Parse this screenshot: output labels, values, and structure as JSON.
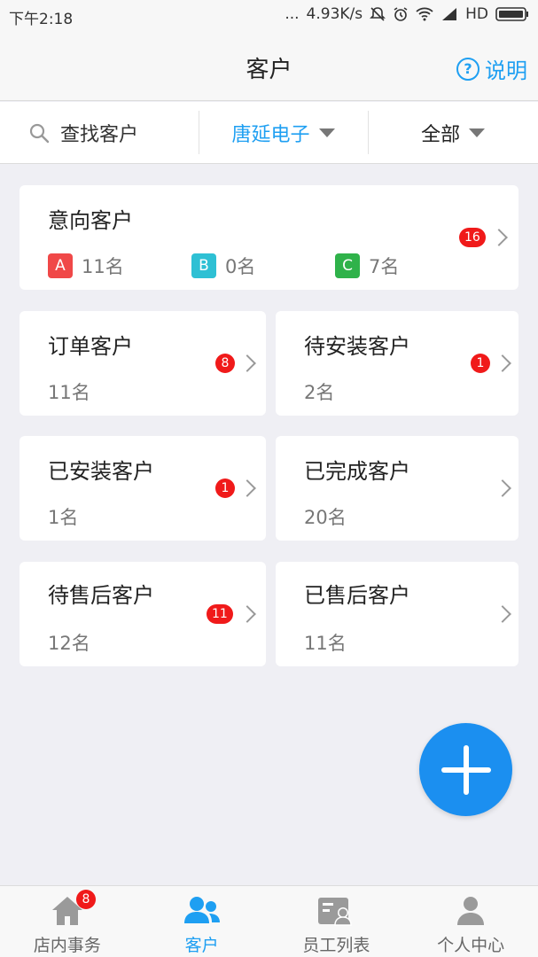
{
  "statusbar": {
    "time": "下午2:18",
    "dots": "...",
    "speed": "4.93K/s",
    "network": "HD"
  },
  "header": {
    "title": "客户",
    "help_label": "说明",
    "help_glyph": "?"
  },
  "filters": {
    "search_label": "查找客户",
    "company": "唐延电子",
    "scope": "全部"
  },
  "intent_card": {
    "title": "意向客户",
    "badge": "16",
    "grades": [
      {
        "letter": "A",
        "count": "11名",
        "color": "#f04848"
      },
      {
        "letter": "B",
        "count": "0名",
        "color": "#2ec0d4"
      },
      {
        "letter": "C",
        "count": "7名",
        "color": "#2fb24a"
      }
    ]
  },
  "cards": [
    {
      "title": "订单客户",
      "count": "11名",
      "badge": "8"
    },
    {
      "title": "待安装客户",
      "count": "2名",
      "badge": "1"
    },
    {
      "title": "已安装客户",
      "count": "1名",
      "badge": "1"
    },
    {
      "title": "已完成客户",
      "count": "20名",
      "badge": null
    },
    {
      "title": "待售后客户",
      "count": "12名",
      "badge": "11"
    },
    {
      "title": "已售后客户",
      "count": "11名",
      "badge": null
    }
  ],
  "tabs": [
    {
      "label": "店内事务",
      "badge": "8"
    },
    {
      "label": "客户"
    },
    {
      "label": "员工列表"
    },
    {
      "label": "个人中心"
    }
  ],
  "colors": {
    "accent": "#1e9ff2",
    "badge": "#f01a1a",
    "fab": "#1b8ff0"
  }
}
